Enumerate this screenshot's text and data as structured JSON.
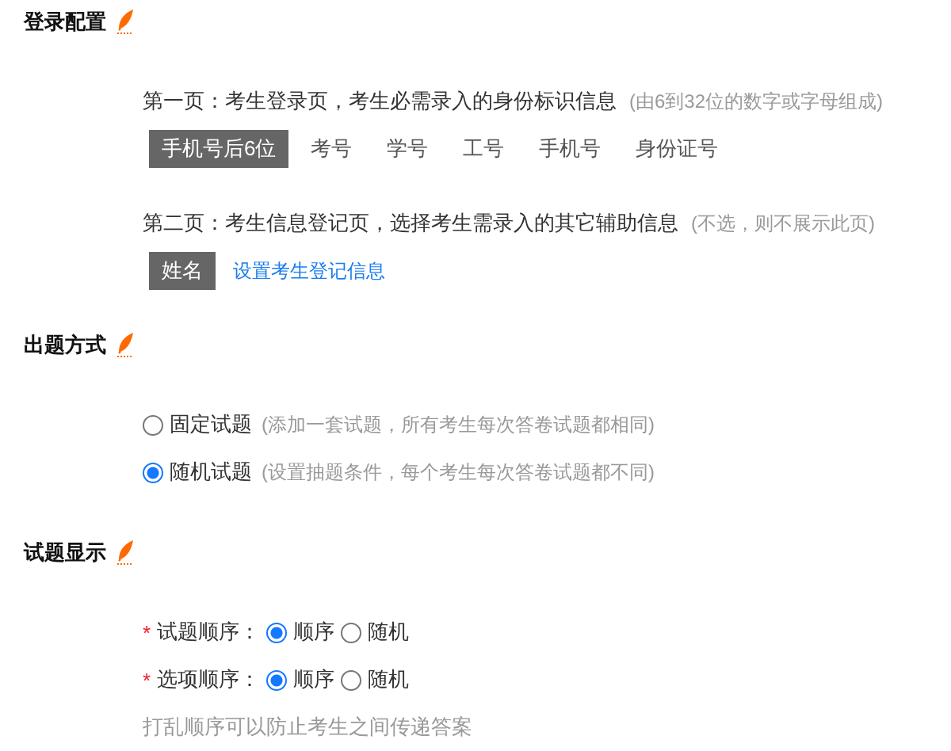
{
  "sections": [
    {
      "kind": "login",
      "title": "登录配置",
      "pages": [
        {
          "label": "第一页：考生登录页，考生必需录入的身份标识信息",
          "hint": "(由6到32位的数字或字母组成)",
          "options": [
            {
              "label": "手机号后6位",
              "selected": true
            },
            {
              "label": "考号",
              "selected": false
            },
            {
              "label": "学号",
              "selected": false
            },
            {
              "label": "工号",
              "selected": false
            },
            {
              "label": "手机号",
              "selected": false
            },
            {
              "label": "身份证号",
              "selected": false
            }
          ]
        },
        {
          "label": "第二页：考生信息登记页，选择考生需录入的其它辅助信息",
          "hint": "(不选，则不展示此页)",
          "options": [
            {
              "label": "姓名",
              "selected": true
            }
          ],
          "link": "设置考生登记信息"
        }
      ]
    },
    {
      "kind": "mode",
      "title": "出题方式",
      "options": [
        {
          "label": "固定试题",
          "hint": "(添加一套试题，所有考生每次答卷试题都相同)",
          "selected": false
        },
        {
          "label": "随机试题",
          "hint": "(设置抽题条件，每个考生每次答卷试题都不同)",
          "selected": true
        }
      ]
    },
    {
      "kind": "display",
      "title": "试题显示",
      "settings": [
        {
          "marker": "*",
          "label": "试题顺序：",
          "options": [
            {
              "label": "顺序",
              "selected": true
            },
            {
              "label": "随机",
              "selected": false
            }
          ]
        },
        {
          "marker": "*",
          "label": "选项顺序：",
          "options": [
            {
              "label": "顺序",
              "selected": true
            },
            {
              "label": "随机",
              "selected": false
            }
          ]
        }
      ],
      "note": "打乱顺序可以防止考生之间传递答案"
    }
  ]
}
